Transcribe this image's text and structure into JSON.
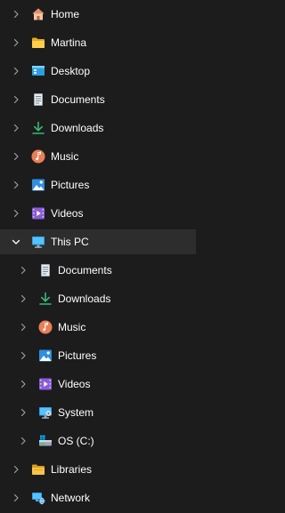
{
  "nav_pane": {
    "items": [
      {
        "label": "Home",
        "icon": "home-icon",
        "level": 0,
        "expanded": false
      },
      {
        "label": "Martina",
        "icon": "folder-icon",
        "level": 0,
        "expanded": false
      },
      {
        "label": "Desktop",
        "icon": "desktop-icon",
        "level": 0,
        "expanded": false
      },
      {
        "label": "Documents",
        "icon": "documents-icon",
        "level": 0,
        "expanded": false
      },
      {
        "label": "Downloads",
        "icon": "downloads-icon",
        "level": 0,
        "expanded": false
      },
      {
        "label": "Music",
        "icon": "music-icon",
        "level": 0,
        "expanded": false
      },
      {
        "label": "Pictures",
        "icon": "pictures-icon",
        "level": 0,
        "expanded": false
      },
      {
        "label": "Videos",
        "icon": "videos-icon",
        "level": 0,
        "expanded": false
      },
      {
        "label": "This PC",
        "icon": "this-pc-icon",
        "level": 0,
        "expanded": true,
        "selected": true
      },
      {
        "label": "Documents",
        "icon": "documents-icon",
        "level": 1,
        "expanded": false
      },
      {
        "label": "Downloads",
        "icon": "downloads-icon",
        "level": 1,
        "expanded": false
      },
      {
        "label": "Music",
        "icon": "music-icon",
        "level": 1,
        "expanded": false
      },
      {
        "label": "Pictures",
        "icon": "pictures-icon",
        "level": 1,
        "expanded": false
      },
      {
        "label": "Videos",
        "icon": "videos-icon",
        "level": 1,
        "expanded": false
      },
      {
        "label": "System",
        "icon": "system-icon",
        "level": 1,
        "expanded": false
      },
      {
        "label": "OS (C:)",
        "icon": "drive-icon",
        "level": 1,
        "expanded": false
      },
      {
        "label": "Libraries",
        "icon": "libraries-icon",
        "level": 0,
        "expanded": false
      },
      {
        "label": "Network",
        "icon": "network-icon",
        "level": 0,
        "expanded": false
      }
    ]
  },
  "colors": {
    "background": "#1c1c1c",
    "selected_row": "#2d2d2d",
    "text": "#ffffff",
    "chevron": "#9e9e9e"
  }
}
